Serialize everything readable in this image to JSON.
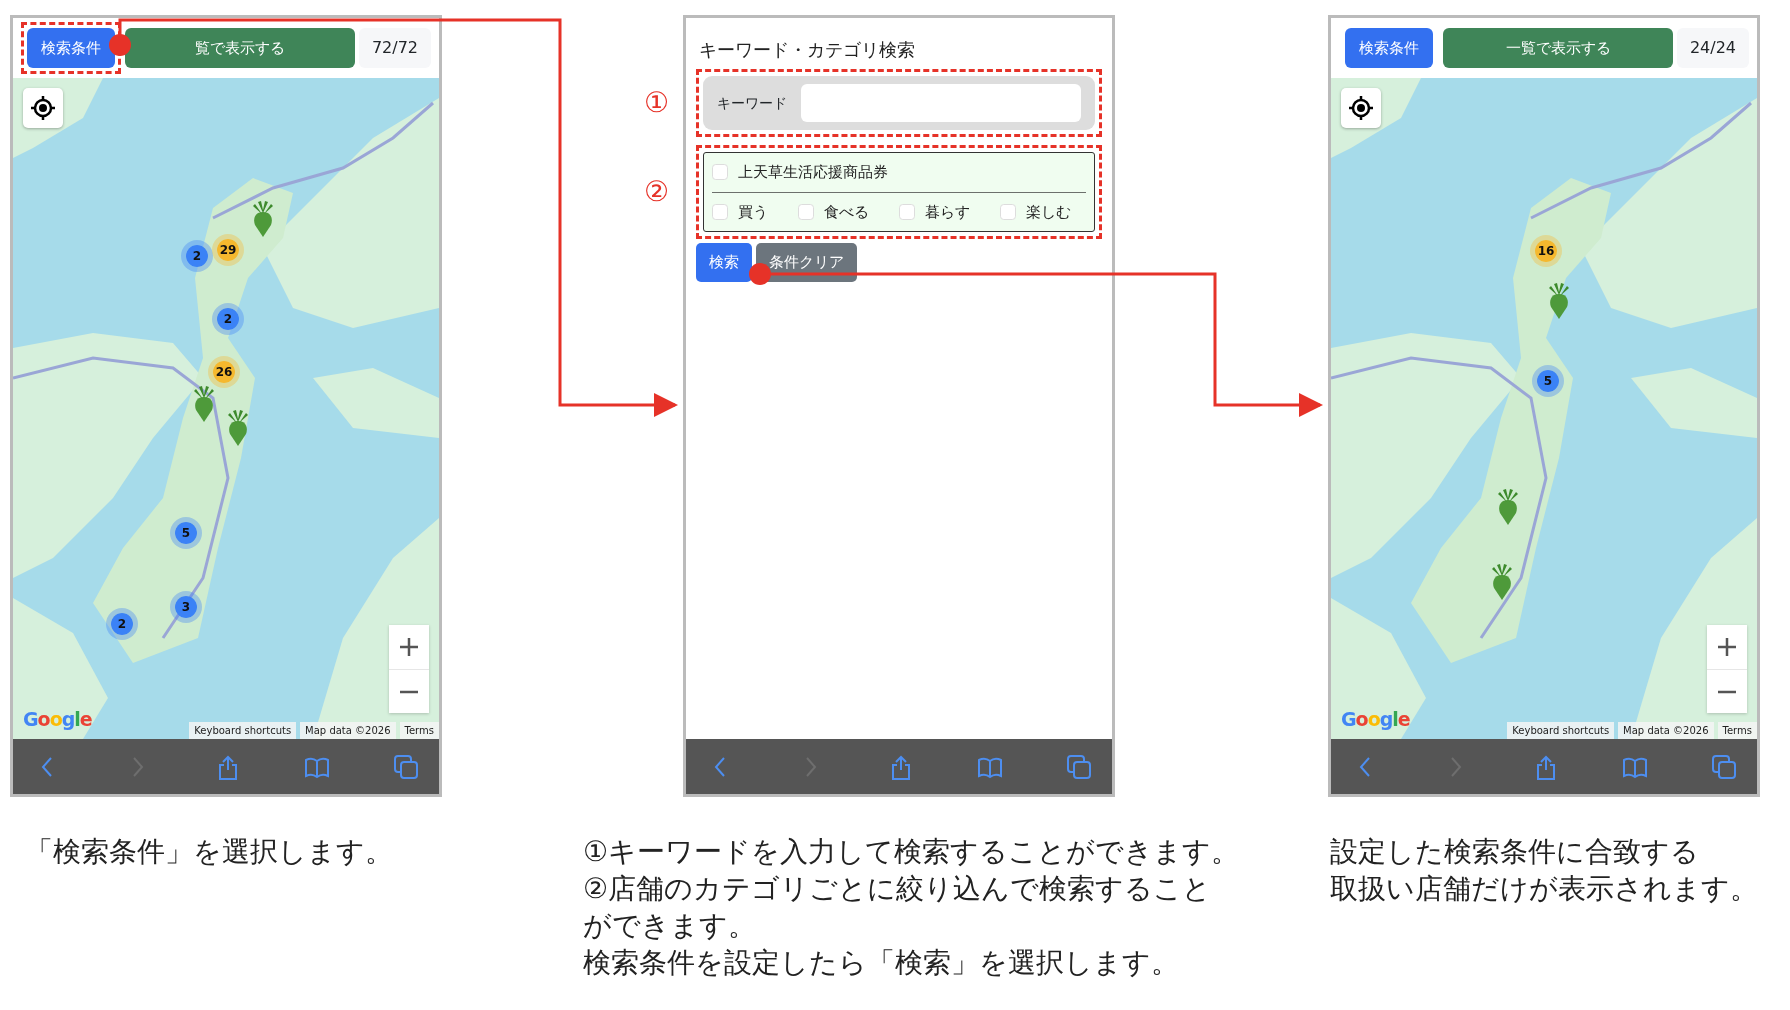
{
  "phones": [
    {
      "kind": "map",
      "top_bar": {
        "conditions_button": {
          "label": "検索条件",
          "highlighted": true
        },
        "list_button": "覧で表示する",
        "count": "72/72"
      },
      "markers": [
        {
          "kind": "cluster",
          "count": "2",
          "color": "#3b82f6"
        },
        {
          "kind": "cluster",
          "count": "29",
          "color": "#f5b82e"
        },
        {
          "kind": "cluster",
          "count": "2",
          "color": "#3b82f6"
        },
        {
          "kind": "cluster",
          "count": "26",
          "color": "#f5b82e"
        },
        {
          "kind": "cluster",
          "count": "5",
          "color": "#3b82f6"
        },
        {
          "kind": "cluster",
          "count": "3",
          "color": "#3b82f6"
        },
        {
          "kind": "cluster",
          "count": "2",
          "color": "#3b82f6"
        },
        {
          "kind": "pin"
        },
        {
          "kind": "pin"
        },
        {
          "kind": "pin"
        }
      ],
      "google_logo": "Google",
      "attribution": [
        "Keyboard shortcuts",
        "Map data ©2026",
        "Terms"
      ],
      "browser_toolbar": [
        {
          "kind": "back",
          "disabled": false
        },
        {
          "kind": "forward",
          "disabled": true
        },
        {
          "kind": "share",
          "disabled": false
        },
        {
          "kind": "bookmarks",
          "disabled": false
        },
        {
          "kind": "tabs",
          "disabled": false
        }
      ]
    },
    {
      "kind": "search_form",
      "form": {
        "title": "キーワード・カテゴリ検索",
        "keyword": {
          "label": "キーワード",
          "number": "①"
        },
        "categories": {
          "number": "②",
          "main": {
            "label": "上天草生活応援商品券",
            "checked": false
          },
          "items": [
            {
              "label": "買う",
              "checked": false
            },
            {
              "label": "食べる",
              "checked": false
            },
            {
              "label": "暮らす",
              "checked": false
            },
            {
              "label": "楽しむ",
              "checked": false
            }
          ]
        },
        "buttons": [
          {
            "label": "検索",
            "kind": "primary"
          },
          {
            "label": "条件クリア",
            "kind": "secondary"
          }
        ]
      },
      "browser_toolbar": [
        {
          "kind": "back",
          "disabled": false
        },
        {
          "kind": "forward",
          "disabled": true
        },
        {
          "kind": "share",
          "disabled": false
        },
        {
          "kind": "bookmarks",
          "disabled": false
        },
        {
          "kind": "tabs",
          "disabled": false
        }
      ]
    },
    {
      "kind": "map",
      "top_bar": {
        "conditions_button": {
          "label": "検索条件",
          "highlighted": false
        },
        "list_button": "一覧で表示する",
        "count": "24/24"
      },
      "markers": [
        {
          "kind": "cluster",
          "count": "16",
          "color": "#f5b82e"
        },
        {
          "kind": "cluster",
          "count": "5",
          "color": "#3b82f6"
        },
        {
          "kind": "pin"
        },
        {
          "kind": "pin"
        },
        {
          "kind": "pin"
        }
      ],
      "google_logo": "Google",
      "attribution": [
        "Keyboard shortcuts",
        "Map data ©2026",
        "Terms"
      ],
      "browser_toolbar": [
        {
          "kind": "back",
          "disabled": false
        },
        {
          "kind": "forward",
          "disabled": true
        },
        {
          "kind": "share",
          "disabled": false
        },
        {
          "kind": "bookmarks",
          "disabled": false
        },
        {
          "kind": "tabs",
          "disabled": false
        }
      ]
    }
  ],
  "captions": [
    {
      "lines": [
        "「検索条件」を選択します。"
      ]
    },
    {
      "lines": [
        "①キーワードを入力して検索することができます。",
        "②店舗のカテゴリごとに絞り込んで検索すること",
        "ができます。",
        "検索条件を設定したら「検索」を選択します。"
      ]
    },
    {
      "lines": [
        "設定した検索条件に合致する",
        "取扱い店舗だけが表示されます。"
      ]
    }
  ]
}
